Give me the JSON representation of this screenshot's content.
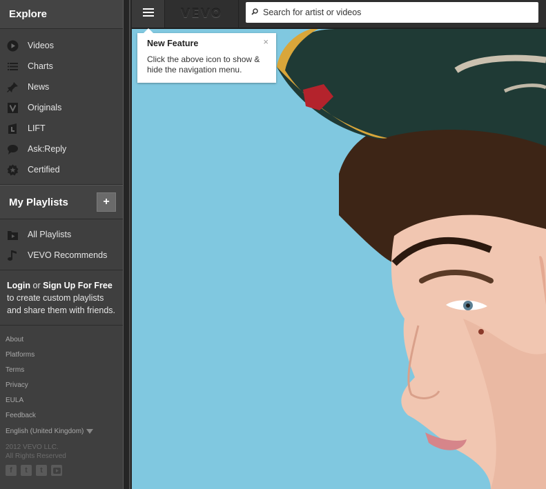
{
  "sidebar": {
    "explore_title": "Explore",
    "explore_items": [
      {
        "label": "Videos",
        "icon": "play-icon"
      },
      {
        "label": "Charts",
        "icon": "list-icon"
      },
      {
        "label": "News",
        "icon": "pin-icon"
      },
      {
        "label": "Originals",
        "icon": "vevo-v-icon"
      },
      {
        "label": "LIFT",
        "icon": "lift-icon"
      },
      {
        "label": "Ask:Reply",
        "icon": "speech-bubble-icon"
      },
      {
        "label": "Certified",
        "icon": "certified-badge-icon"
      }
    ],
    "playlists_title": "My Playlists",
    "add_playlist_label": "+",
    "playlist_items": [
      {
        "label": "All Playlists",
        "icon": "folder-play-icon"
      },
      {
        "label": "VEVO Recommends",
        "icon": "music-note-icon"
      }
    ],
    "login_blurb": {
      "login": "Login",
      "or": " or ",
      "signup": "Sign Up For Free",
      "rest": " to create custom playlists and share them with friends."
    },
    "footer_links": [
      "About",
      "Platforms",
      "Terms",
      "Privacy",
      "EULA",
      "Feedback"
    ],
    "language": "English (United Kingdom)",
    "copyright_line1": "2012 VEVO LLC.",
    "copyright_line2": "All Rights Reserved",
    "socials": [
      "facebook-icon",
      "twitter-icon",
      "tumblr-icon",
      "youtube-icon"
    ]
  },
  "topbar": {
    "logo": "VEVO",
    "search_placeholder": "Search for artist or videos"
  },
  "tooltip": {
    "title": "New Feature",
    "body": "Click the above icon to show & hide the navigation menu.",
    "close": "×"
  },
  "colors": {
    "sidebar_bg": "#3f3f3f",
    "hero_sky": "#7fc7df",
    "cap_green": "#1e3a35",
    "cap_maroon": "#7a1e2e",
    "cap_brim_gold": "#d9a63a"
  }
}
